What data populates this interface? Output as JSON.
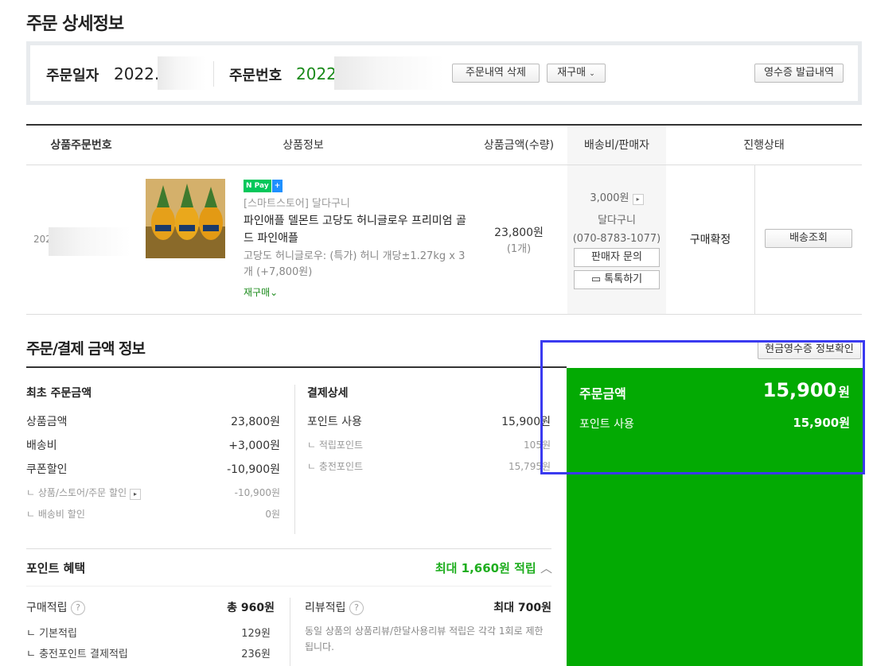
{
  "page": {
    "title": "주문 상세정보"
  },
  "order": {
    "date_label": "주문일자",
    "date_value": "2022.",
    "number_label": "주문번호",
    "number_value": "2022",
    "delete_button": "주문내역 삭제",
    "reorder_button": "재구매",
    "receipt_button": "영수증 발급내역"
  },
  "table": {
    "headers": [
      "상품주문번호",
      "상품정보",
      "상품금액(수량)",
      "배송비/판매자",
      "진행상태"
    ],
    "product_order_no": "202",
    "npay_badge": "Pay",
    "store": "[스마트스토어] 달다구니",
    "product_name": "파인애플 델몬트 고당도 허니글로우 프리미엄 골드 파인애플",
    "option": "고당도 허니글로우: (특가) 허니 개당±1.27kg x 3개 (+7,800원)",
    "reorder_link": "재구매",
    "price": "23,800원",
    "qty": "(1개)",
    "shipping_fee": "3,000원",
    "seller": "달다구니",
    "seller_phone": "(070-8783-1077)",
    "seller_inquiry_button": "판매자 문의",
    "talk_button": "톡톡하기",
    "status": "구매확정",
    "tracking_button": "배송조회"
  },
  "payment": {
    "section_title": "주문/결제 금액 정보",
    "cash_receipt_button": "현금영수증 정보확인",
    "initial_title": "최초 주문금액",
    "rows": [
      {
        "label": "상품금액",
        "value": "23,800원"
      },
      {
        "label": "배송비",
        "value": "+3,000원"
      },
      {
        "label": "쿠폰할인",
        "value": "-10,900원"
      }
    ],
    "sub_rows": [
      {
        "label": "ㄴ 상품/스토어/주문 할인",
        "value": "-10,900원"
      },
      {
        "label": "ㄴ 배송비 할인",
        "value": "0원"
      }
    ],
    "detail_title": "결제상세",
    "point_use_label": "포인트 사용",
    "point_use_value": "15,900원",
    "detail_sub": [
      {
        "label": "ㄴ 적립포인트",
        "value": "105원"
      },
      {
        "label": "ㄴ 충전포인트",
        "value": "15,795원"
      }
    ],
    "order_amount_label": "주문금액",
    "order_amount_value": "15,900",
    "order_amount_unit": "원",
    "point_use_summary_label": "포인트 사용",
    "point_use_summary_value": "15,900원"
  },
  "points": {
    "title": "포인트 혜택",
    "max_label": "최대 1,660원 적립",
    "purchase_label": "구매적립",
    "purchase_total": "총 960원",
    "basic_label": "ㄴ 기본적립",
    "basic_value": "129원",
    "charge_label": "ㄴ 충전포인트 결제적립",
    "charge_value": "236원",
    "review_label": "리뷰적립",
    "review_max": "최대 700원",
    "review_note": "동일 상품의 상품리뷰/한달사용리뷰 적립은 각각 1회로 제한됩니다.",
    "help_glyph": "?"
  },
  "colors": {
    "accent_green": "#03aa03",
    "highlight": "#3a3af0",
    "text_green": "#1a8a1a"
  }
}
